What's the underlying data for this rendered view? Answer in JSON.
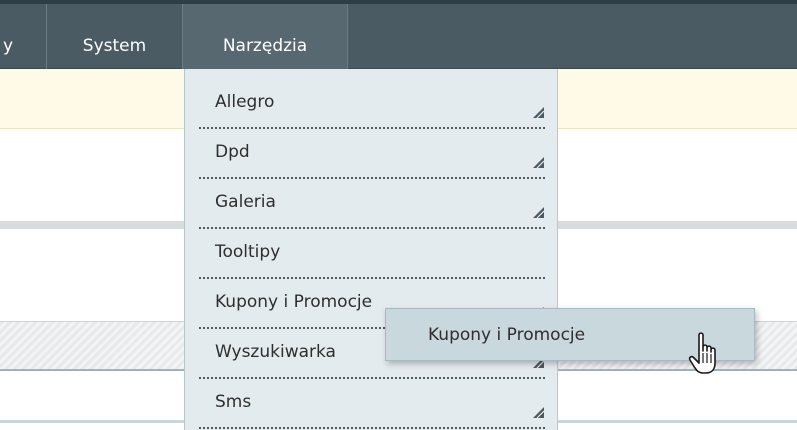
{
  "nav": {
    "prev_label": "y",
    "items": [
      {
        "label": "System"
      },
      {
        "label": "Narzędzia"
      }
    ]
  },
  "menu": {
    "items": [
      {
        "label": "Allegro",
        "has_submenu": true
      },
      {
        "label": "Dpd",
        "has_submenu": true
      },
      {
        "label": "Galeria",
        "has_submenu": true
      },
      {
        "label": "Tooltipy",
        "has_submenu": false
      },
      {
        "label": "Kupony i Promocje",
        "has_submenu": true
      },
      {
        "label": "Wyszukiwarka",
        "has_submenu": true
      },
      {
        "label": "Sms",
        "has_submenu": true
      }
    ]
  },
  "submenu": {
    "items": [
      {
        "label": "Kupony i Promocje"
      }
    ]
  },
  "colors": {
    "topbar": "#4b5b63",
    "menu_bg": "#e4ebee",
    "flyout_bg": "#c9d8dd",
    "notice_bg": "#fff9e8"
  },
  "icons": {
    "submenu_indicator": "corner-arrow-icon",
    "pointer": "hand-cursor-icon"
  }
}
